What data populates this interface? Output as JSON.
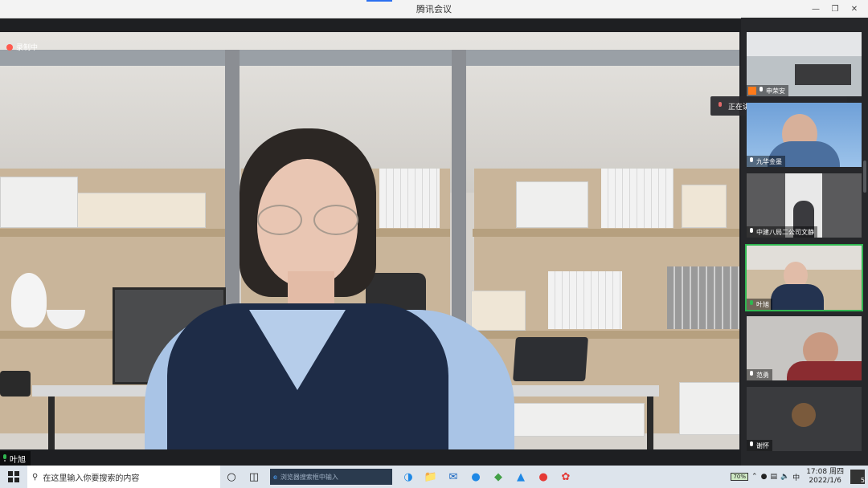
{
  "window": {
    "title": "腾讯会议"
  },
  "recording": {
    "label": "录制中"
  },
  "main_video": {
    "speaker_name": "叶旭"
  },
  "speaking_indicator": {
    "label": "正在讲话: 叶旭"
  },
  "participants": [
    {
      "name": "申荣安",
      "role": "host"
    },
    {
      "name": "九华金墨"
    },
    {
      "name": "中建八局二公司文静"
    },
    {
      "name": "叶旭",
      "active": true
    },
    {
      "name": "范勇"
    },
    {
      "name": "谢怀"
    }
  ],
  "taskbar": {
    "search_placeholder": "在这里输入你要搜索的内容",
    "browser_search_placeholder": "浏览器搜索框中输入",
    "battery": "70%",
    "time": "17:08 周四",
    "date": "2022/1/6",
    "notifications": "5"
  },
  "colors": {
    "active_outline": "#2fb650",
    "record_red": "#ff5a4e",
    "taskbar": "#dde4ec"
  }
}
